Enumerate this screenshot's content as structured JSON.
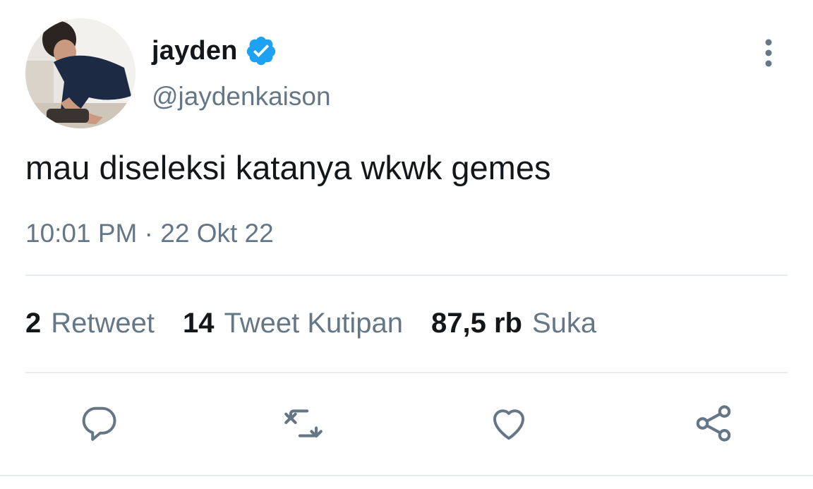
{
  "author": {
    "display_name": "jayden",
    "handle": "@jaydenkaison",
    "verified": true,
    "avatar": "profile-photo"
  },
  "tweet": {
    "text": "mau diseleksi katanya wkwk gemes",
    "time": "10:01 PM",
    "separator": " · ",
    "date": "22 Okt 22"
  },
  "stats": {
    "retweets": {
      "count": "2",
      "label": "Retweet"
    },
    "quotes": {
      "count": "14",
      "label": "Tweet Kutipan"
    },
    "likes": {
      "count": "87,5 rb",
      "label": "Suka"
    }
  },
  "actions": {
    "reply_icon": "reply-icon",
    "retweet_icon": "retweet-icon",
    "like_icon": "heart-icon",
    "share_icon": "share-icon",
    "more_icon": "more-vertical-icon"
  },
  "colors": {
    "text": "#14171a",
    "secondary": "#657786",
    "verified": "#1da1f2",
    "icon": "#657786",
    "divider": "#e6ecf0"
  }
}
